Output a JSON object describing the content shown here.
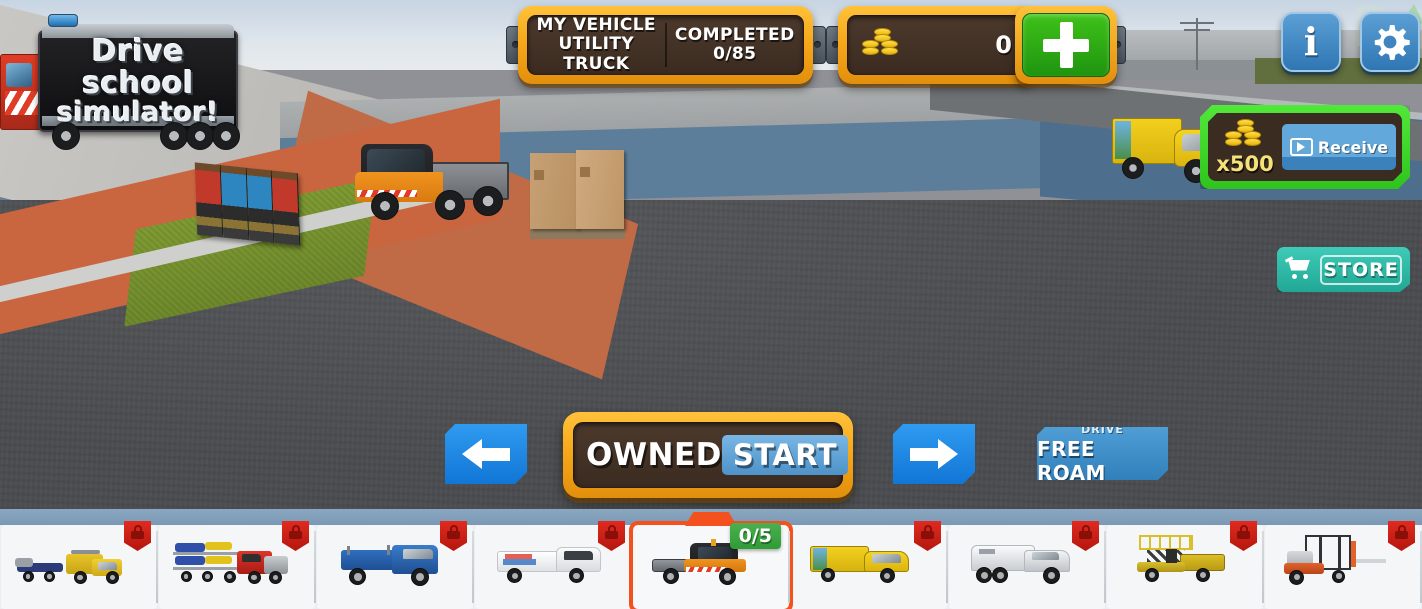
{
  "game": {
    "logo_line1": "Drive school",
    "logo_line2": "simulator!"
  },
  "hud": {
    "my_vehicle_label": "MY VEHICLE",
    "my_vehicle_name": "UTILITY TRUCK",
    "completed_label": "COMPLETED",
    "completed_value": "0/85",
    "coin_value": "0",
    "add_coins_label": "+",
    "info_label": "i",
    "settings_label": "gear-icon"
  },
  "reward": {
    "multiplier": "x500",
    "receive_label": "Receive"
  },
  "store": {
    "label": "STORE"
  },
  "controls": {
    "prev_label": "left-arrow",
    "next_label": "right-arrow",
    "owned_label": "OWNED",
    "start_label": "START",
    "freeroam_sub": "DRIVE",
    "freeroam_main": "FREE ROAM"
  },
  "vehicle_bar": {
    "items": [
      {
        "name": "tow-truck-with-trailer",
        "locked": true,
        "badge": ""
      },
      {
        "name": "car-carrier-truck",
        "locked": true,
        "badge": ""
      },
      {
        "name": "blue-dump-truck",
        "locked": true,
        "badge": ""
      },
      {
        "name": "white-cargo-van",
        "locked": true,
        "badge": ""
      },
      {
        "name": "utility-truck",
        "locked": false,
        "badge": "0/5",
        "selected": true
      },
      {
        "name": "yellow-box-truck",
        "locked": true,
        "badge": ""
      },
      {
        "name": "white-semi-tractor",
        "locked": true,
        "badge": ""
      },
      {
        "name": "scissor-lift-truck",
        "locked": true,
        "badge": ""
      },
      {
        "name": "forklift",
        "locked": true,
        "badge": ""
      }
    ]
  },
  "colors": {
    "hud_frame": "#f7a81b",
    "hud_inner": "#4c392c",
    "accent_blue": "#2f9bf0",
    "green_reward": "#3ac722",
    "store_teal": "#2fbcaa",
    "selected_orange": "#f4511e",
    "lock_red": "#c8180f",
    "badge_green": "#3a9f3c"
  }
}
